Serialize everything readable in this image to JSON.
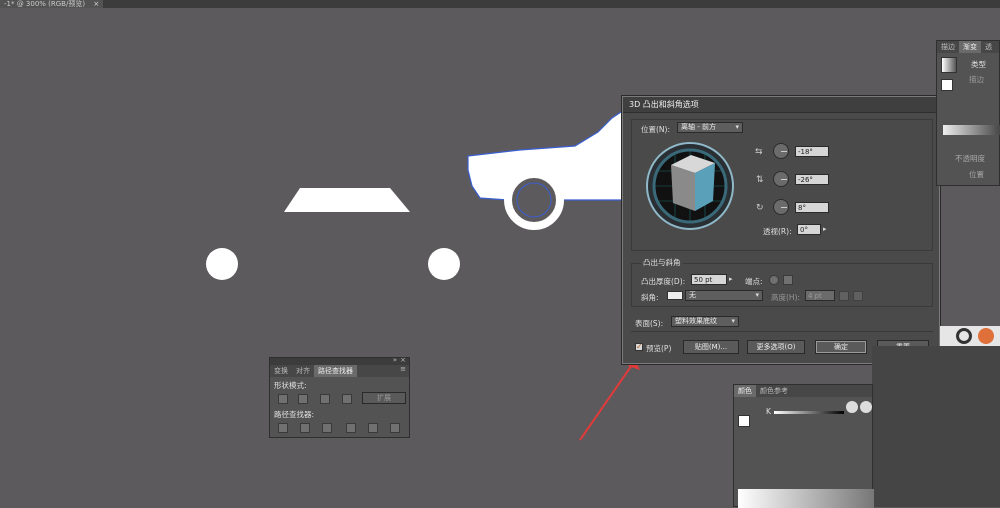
{
  "document_tab": {
    "title": "-1* @ 300% (RGB/预览)",
    "close": "×"
  },
  "dialog": {
    "title": "3D 凸出和斜角选项",
    "position": {
      "label": "位置(N):",
      "value": "离轴 - 前方"
    },
    "rotation": {
      "x": "-18°",
      "y": "-26°",
      "z": "8°"
    },
    "perspective": {
      "label": "透视(R):",
      "value": "0°"
    },
    "extrude_section": "凸出与斜角",
    "extrude_depth": {
      "label": "凸出厚度(D):",
      "value": "50 pt"
    },
    "cap_label": "端点:",
    "bevel": {
      "label": "斜角:",
      "value": "无"
    },
    "height": {
      "label": "高度(H):",
      "value": "4 pt"
    },
    "surface": {
      "label": "表面(S):",
      "value": "塑料效果底纹"
    },
    "preview_label": "预览(P)",
    "map_button": "贴图(M)...",
    "more_options_button": "更多选项(O)",
    "ok_button": "确定",
    "reset_button": "重置"
  },
  "pathfinder": {
    "tabs": [
      "变换",
      "对齐",
      "路径查找器"
    ],
    "shape_modes_label": "形状模式:",
    "expand_button": "扩展",
    "pathfinders_label": "路径查找器:"
  },
  "gradient_panel": {
    "tabs": [
      "描边",
      "渐变",
      "透"
    ],
    "type_label": "类型",
    "stroke_label": "描边",
    "opacity_label": "不透明度",
    "location_label": "位置"
  },
  "color_panel": {
    "tabs": [
      "颜色",
      "颜色参考"
    ],
    "k_label": "K"
  },
  "colors": {
    "canvas": "#5d5a5d",
    "cube_front": "#5aa0b8",
    "cube_side": "#8a8a8a",
    "cube_top": "#d8d8d8",
    "arrow": "#e03a3a"
  }
}
